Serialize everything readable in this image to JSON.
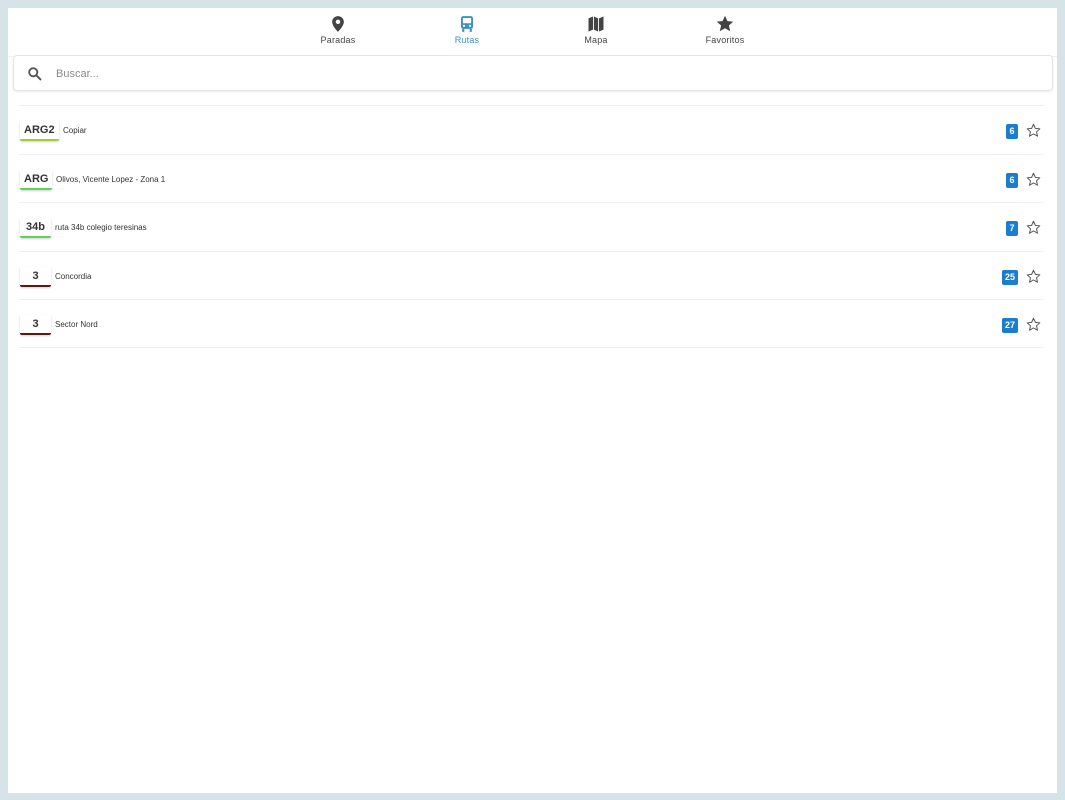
{
  "tabs": [
    {
      "id": "paradas",
      "label": "Paradas",
      "icon": "map-pin-icon",
      "active": false
    },
    {
      "id": "rutas",
      "label": "Rutas",
      "icon": "bus-icon",
      "active": true
    },
    {
      "id": "mapa",
      "label": "Mapa",
      "icon": "map-icon",
      "active": false
    },
    {
      "id": "favoritos",
      "label": "Favoritos",
      "icon": "star-icon",
      "active": false
    }
  ],
  "search": {
    "placeholder": "Buscar...",
    "value": ""
  },
  "routes": [
    {
      "code": "ARG2",
      "name": "Copiar",
      "count": "6",
      "color": "#a8c83c"
    },
    {
      "code": "ARG",
      "name": "Olivos, Vicente Lopez - Zona 1",
      "count": "6",
      "color": "#5fd35a"
    },
    {
      "code": "34b",
      "name": "ruta 34b colegio teresinas",
      "count": "7",
      "color": "#5fd35a"
    },
    {
      "code": "3",
      "name": "Concordia",
      "count": "25",
      "color": "#5a1a1a"
    },
    {
      "code": "3",
      "name": "Sector Nord",
      "count": "27",
      "color": "#5a1a1a"
    }
  ],
  "colors": {
    "accent": "#3b8fce",
    "badge": "#1a7dd0",
    "icon": "#444444"
  }
}
